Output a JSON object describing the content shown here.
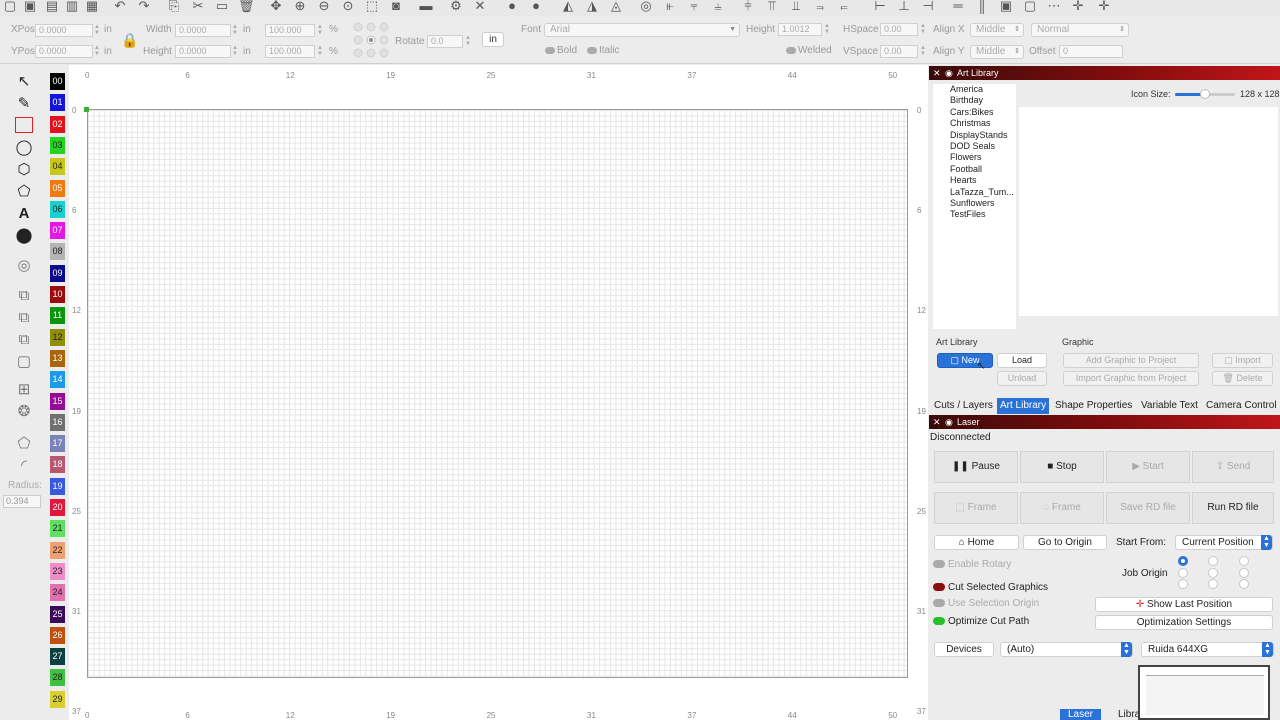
{
  "propbar": {
    "xpos_label": "XPos",
    "xpos_value": "0.0000",
    "ypos_label": "YPos",
    "ypos_value": "0.0000",
    "width_label": "Width",
    "width_value": "0.0000",
    "height_label": "Height",
    "height_value": "0.0000",
    "unit_in": "in",
    "pct_w": "100.000",
    "pct_h": "100.000",
    "pct_sign": "%",
    "rotate_label": "Rotate",
    "rotate_value": "0.0",
    "units_button": "in",
    "font_label": "Font",
    "font_value": "Arial",
    "bold_label": "Bold",
    "italic_label": "Italic",
    "text_height_label": "Height",
    "text_height_value": "1.0012",
    "welded_label": "Welded",
    "hspace_label": "HSpace",
    "hspace_value": "0.00",
    "vspace_label": "VSpace",
    "vspace_value": "0.00",
    "alignx_label": "Align X",
    "alignx_value": "Middle",
    "aligny_label": "Align Y",
    "aligny_value": "Middle",
    "mode_value": "Normal",
    "offset_label": "Offset",
    "offset_value": "0"
  },
  "tools": {
    "radius_label": "Radius:",
    "radius_value": "0.394"
  },
  "palette": [
    {
      "id": "00",
      "color": "#000000"
    },
    {
      "id": "01",
      "color": "#1515d9"
    },
    {
      "id": "02",
      "color": "#e0131b"
    },
    {
      "id": "03",
      "color": "#22d322"
    },
    {
      "id": "04",
      "color": "#c8c81a"
    },
    {
      "id": "05",
      "color": "#f07a10"
    },
    {
      "id": "06",
      "color": "#18d0d0"
    },
    {
      "id": "07",
      "color": "#e418e4"
    },
    {
      "id": "08",
      "color": "#b4b4b4"
    },
    {
      "id": "09",
      "color": "#0b0b8c"
    },
    {
      "id": "10",
      "color": "#9b0b0b"
    },
    {
      "id": "11",
      "color": "#0b950b"
    },
    {
      "id": "12",
      "color": "#8e8e0b"
    },
    {
      "id": "13",
      "color": "#a8650b"
    },
    {
      "id": "14",
      "color": "#1b9be8"
    },
    {
      "id": "15",
      "color": "#950b95"
    },
    {
      "id": "16",
      "color": "#707070"
    },
    {
      "id": "17",
      "color": "#7a82b8"
    },
    {
      "id": "18",
      "color": "#b85870"
    },
    {
      "id": "19",
      "color": "#3858e0"
    },
    {
      "id": "20",
      "color": "#e0183c"
    },
    {
      "id": "21",
      "color": "#60e060"
    },
    {
      "id": "22",
      "color": "#f0a070"
    },
    {
      "id": "23",
      "color": "#f08cc8"
    },
    {
      "id": "24",
      "color": "#e070b0"
    },
    {
      "id": "25",
      "color": "#3a0a5a"
    },
    {
      "id": "26",
      "color": "#c05010"
    },
    {
      "id": "27",
      "color": "#0b4040"
    },
    {
      "id": "28",
      "color": "#40c040"
    },
    {
      "id": "29",
      "color": "#d8d030"
    }
  ],
  "ruler": {
    "x_ticks": [
      "0",
      "6",
      "12",
      "19",
      "25",
      "31",
      "37",
      "44",
      "50"
    ],
    "y_ticks": [
      "0",
      "6",
      "12",
      "19",
      "25",
      "31",
      "37"
    ]
  },
  "art_library": {
    "title": "Art Library",
    "categories": [
      "America",
      "Birthday",
      "Cars:Bikes",
      "Christmas",
      "DisplayStands",
      "DOD Seals",
      "Flowers",
      "Football",
      "Hearts",
      "LaTazza_Tum...",
      "Sunflowers",
      "TestFiles"
    ],
    "icon_size_label": "Icon Size:",
    "icon_size_value": "128 x 128",
    "icon_size_level": 0.5,
    "section_label": "Art Library",
    "new_button": "New",
    "load_button": "Load",
    "unload_button": "Unload",
    "graphic_label": "Graphic",
    "add_graphic_button": "Add Graphic to Project",
    "import_graphic_button": "Import Graphic from Project",
    "import_button": "Import",
    "delete_button": "Delete"
  },
  "tabs": [
    "Cuts / Layers",
    "Art Library",
    "Shape Properties",
    "Variable Text",
    "Camera Control"
  ],
  "active_tab": "Art Library",
  "laser": {
    "title": "Laser",
    "status": "Disconnected",
    "pause": "Pause",
    "stop": "Stop",
    "start": "Start",
    "send": "Send",
    "frame1": "Frame",
    "frame2": "Frame",
    "save_rd": "Save RD file",
    "run_rd": "Run RD file",
    "home": "Home",
    "go_to_origin": "Go to Origin",
    "start_from_label": "Start From:",
    "start_from_value": "Current Position",
    "enable_rotary": "Enable Rotary",
    "job_origin_label": "Job Origin",
    "cut_selected": "Cut Selected Graphics",
    "use_selection_origin": "Use Selection Origin",
    "show_last_position": "Show Last Position",
    "optimize_cut_path": "Optimize Cut Path",
    "optimization_settings": "Optimization Settings",
    "devices": "Devices",
    "device_value": "(Auto)",
    "controller_value": "Ruida 644XG"
  },
  "bottom_tabs": [
    "Laser",
    "Library"
  ]
}
